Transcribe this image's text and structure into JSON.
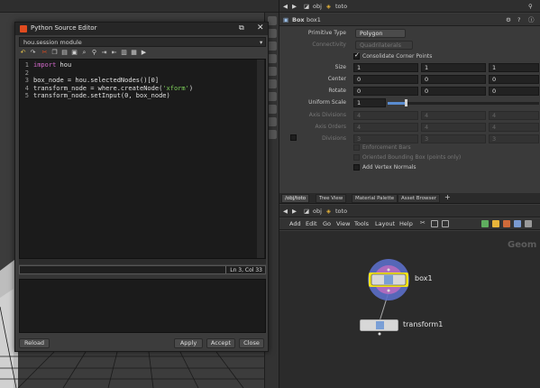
{
  "editor": {
    "title": "Python Source Editor",
    "module": "hou.session module",
    "code_lines": [
      {
        "num": "1",
        "segments": [
          {
            "text": "import",
            "cls": "kw"
          },
          {
            "text": " hou",
            "cls": ""
          }
        ]
      },
      {
        "num": "2",
        "segments": [
          {
            "text": "",
            "cls": ""
          }
        ]
      },
      {
        "num": "3",
        "segments": [
          {
            "text": "box_node = hou.selectedNodes()[0]",
            "cls": ""
          }
        ]
      },
      {
        "num": "4",
        "segments": [
          {
            "text": "transform_node = where.createNode(",
            "cls": ""
          },
          {
            "text": "'xform'",
            "cls": "str"
          },
          {
            "text": ")",
            "cls": ""
          }
        ]
      },
      {
        "num": "5",
        "segments": [
          {
            "text": "transform_node.setInput(0, box_node)",
            "cls": ""
          }
        ]
      }
    ],
    "cursor_position": "Ln 3, Col 33",
    "buttons": {
      "reload": "Reload",
      "apply": "Apply",
      "accept": "Accept",
      "close": "Close"
    }
  },
  "params": {
    "path": "obj",
    "path_node": "toto",
    "node_type": "Box",
    "node_name": "box1",
    "primitive_type_label": "Primitive Type",
    "primitive_type_value": "Polygon",
    "connectivity_label": "Connectivity",
    "connectivity_value": "Quadrilaterals",
    "consolidate_label": "Consolidate Corner Points",
    "size_label": "Size",
    "size_values": [
      "1",
      "1",
      "1"
    ],
    "center_label": "Center",
    "center_values": [
      "0",
      "0",
      "0"
    ],
    "rotate_label": "Rotate",
    "rotate_values": [
      "0",
      "0",
      "0"
    ],
    "uniform_scale_label": "Uniform Scale",
    "uniform_scale_value": "1",
    "axis_divisions_label": "Axis Divisions",
    "axis_divisions_values": [
      "4",
      "4",
      "4"
    ],
    "axis_orders_label": "Axis Orders",
    "axis_orders_values": [
      "4",
      "4",
      "4"
    ],
    "divisions_label": "Divisions",
    "divisions_values": [
      "3",
      "3",
      "3"
    ],
    "enforcement_label": "Enforcement Bars",
    "oriented_label": "Oriented Bounding Box (points only)",
    "vertex_normals_label": "Add Vertex Normals"
  },
  "network": {
    "tabs": [
      "/obj/toto",
      "Tree View",
      "Material Palette",
      "Asset Browser",
      "+"
    ],
    "path": "obj",
    "path_node": "toto",
    "menus": [
      "Add",
      "Edit",
      "Go",
      "View",
      "Tools",
      "Layout",
      "Help"
    ],
    "context_label": "Geom",
    "nodes": {
      "box": "box1",
      "transform": "transform1"
    }
  },
  "colors": {
    "accent_blue": "#5a8cd0",
    "selection_yellow": "#f2e21a",
    "houdini_orange": "#e04b1f"
  }
}
